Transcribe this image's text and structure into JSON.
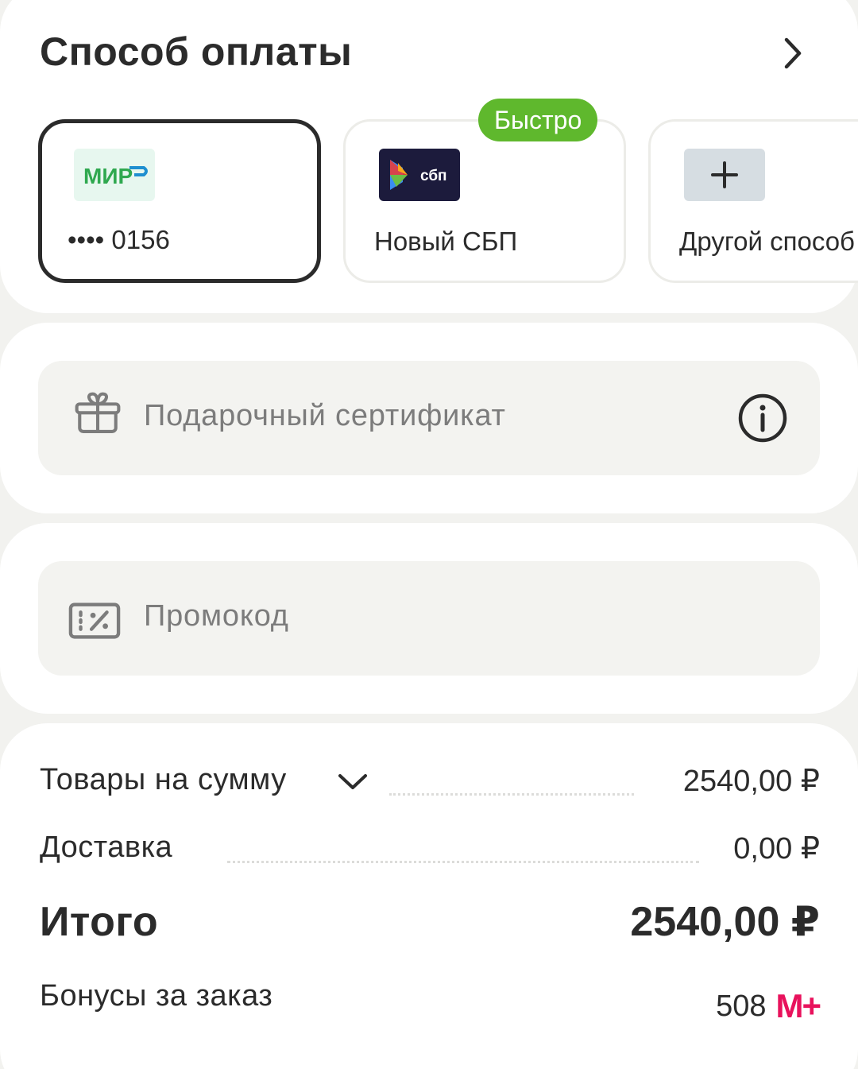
{
  "payment": {
    "title": "Способ оплаты",
    "methods": [
      {
        "label": "•••• 0156",
        "logo": "МИР",
        "selected": true
      },
      {
        "label": "Новый СБП",
        "logo": "сбп",
        "badge": "Быстро",
        "selected": false
      },
      {
        "label": "Другой способ",
        "selected": false
      }
    ]
  },
  "gift": {
    "placeholder": "Подарочный сертификат"
  },
  "promo": {
    "placeholder": "Промокод"
  },
  "summary": {
    "goods_label": "Товары на сумму",
    "goods_value": "2540,00 ₽",
    "delivery_label": "Доставка",
    "delivery_value": "0,00 ₽",
    "total_label": "Итого",
    "total_value": "2540,00 ₽",
    "bonus_label": "Бонусы за заказ",
    "bonus_value": "508",
    "bonus_logo": "М+"
  },
  "colors": {
    "accent_green": "#5fb82d",
    "mir_green": "#2fa84f",
    "sbp_bg": "#1c1b3c",
    "bonus_magenta": "#e8125c"
  }
}
